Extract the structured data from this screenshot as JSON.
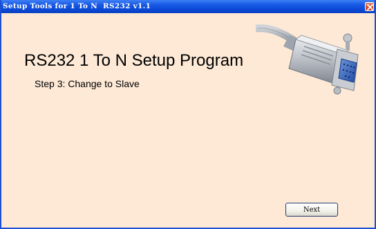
{
  "window": {
    "title": "Setup Tools for 1 To N  RS232 v1.1"
  },
  "main": {
    "heading": "RS232 1 To N Setup Program",
    "step": "Step 3: Change to Slave",
    "image_icon": "db9-serial-cable-icon"
  },
  "footer": {
    "next_label": "Next"
  },
  "colors": {
    "titlebar": "#0b49d6",
    "background": "#fde9d6",
    "connector_blue": "#2f5fb8"
  }
}
